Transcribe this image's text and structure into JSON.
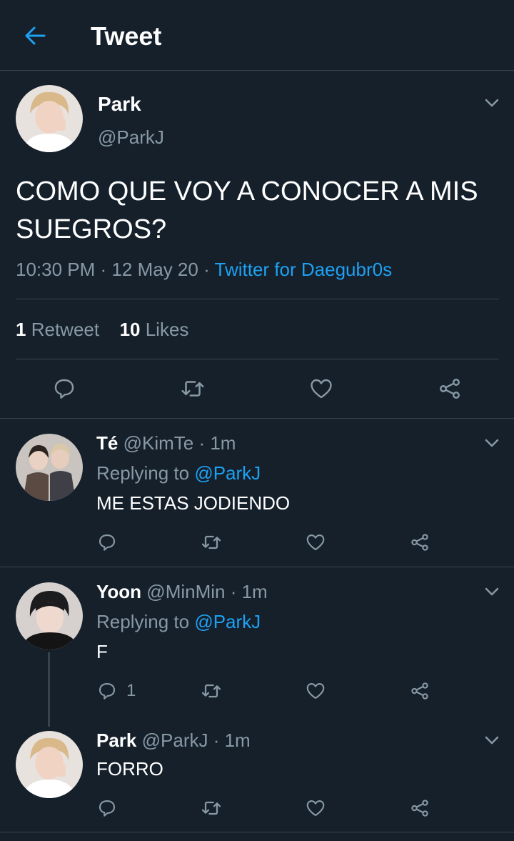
{
  "header": {
    "title": "Tweet"
  },
  "main_tweet": {
    "name": "Park",
    "handle": "@ParkJ",
    "text": "COMO QUE VOY A CONOCER A MIS SUEGROS?",
    "time": "10:30 PM",
    "date": "12 May 20",
    "separator": "·",
    "source": "Twitter for Daegubr0s",
    "retweet_count": "1",
    "retweet_label": "Retweet",
    "likes_count": "10",
    "likes_label": "Likes"
  },
  "replies": [
    {
      "name": "Té",
      "handle": "@KimTe",
      "time": "· 1m",
      "replying_prefix": "Replying to",
      "replying_to": "@ParkJ",
      "text": "ME ESTAS JODIENDO",
      "reply_count": ""
    },
    {
      "name": "Yoon",
      "handle": "@MinMin",
      "time": "· 1m",
      "replying_prefix": "Replying to",
      "replying_to": "@ParkJ",
      "text": "F",
      "reply_count": "1"
    },
    {
      "name": "Park",
      "handle": "@ParkJ",
      "time": "· 1m",
      "text": "FORRO"
    }
  ],
  "icons": {
    "back": "arrow-left-icon",
    "more": "chevron-down-icon",
    "reply": "comment-icon",
    "retweet": "retweet-icon",
    "like": "heart-icon",
    "share": "share-icon"
  },
  "colors": {
    "background": "#15202b",
    "accent": "#1da1f2",
    "muted": "#8899a6",
    "divider": "#38444d"
  }
}
